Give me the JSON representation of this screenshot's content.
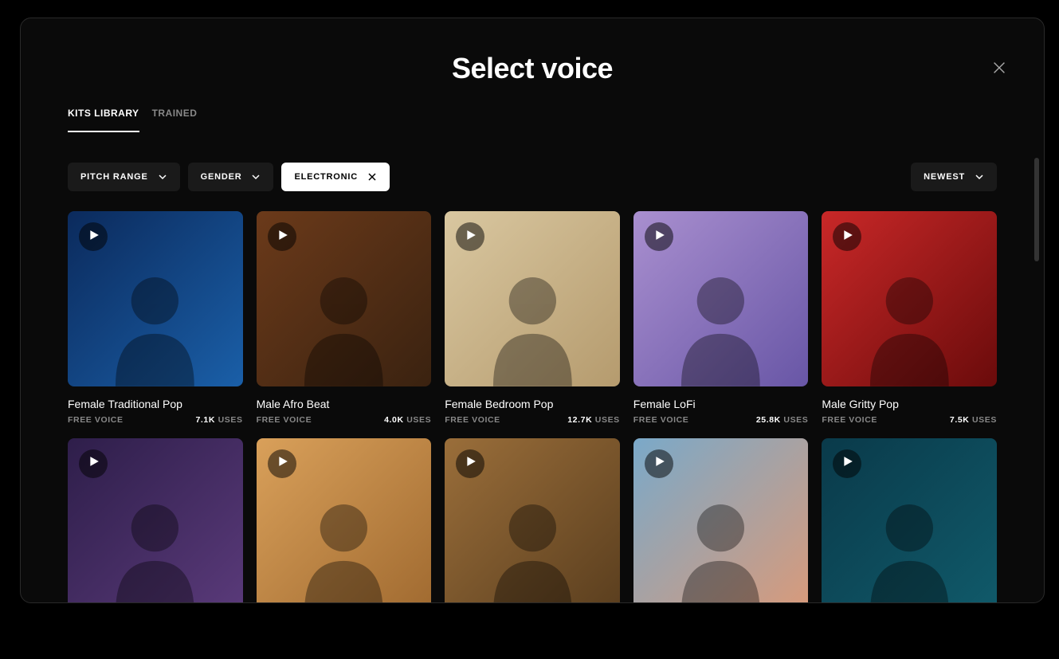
{
  "modal": {
    "title": "Select voice"
  },
  "tabs": [
    {
      "label": "KITS LIBRARY",
      "active": true
    },
    {
      "label": "TRAINED",
      "active": false
    }
  ],
  "filters": {
    "left": [
      {
        "label": "PITCH RANGE",
        "type": "dropdown"
      },
      {
        "label": "GENDER",
        "type": "dropdown"
      },
      {
        "label": "ELECTRONIC",
        "type": "tag",
        "active": true
      }
    ],
    "sort": {
      "label": "NEWEST"
    }
  },
  "uses_suffix": "USES",
  "voices": [
    {
      "title": "Female Traditional Pop",
      "badge": "FREE VOICE",
      "uses": "7.1K"
    },
    {
      "title": "Male Afro Beat",
      "badge": "FREE VOICE",
      "uses": "4.0K"
    },
    {
      "title": "Female Bedroom Pop",
      "badge": "FREE VOICE",
      "uses": "12.7K"
    },
    {
      "title": "Female LoFi",
      "badge": "FREE VOICE",
      "uses": "25.8K"
    },
    {
      "title": "Male Gritty Pop",
      "badge": "FREE VOICE",
      "uses": "7.5K"
    },
    {
      "title": "",
      "badge": "",
      "uses": ""
    },
    {
      "title": "",
      "badge": "",
      "uses": ""
    },
    {
      "title": "",
      "badge": "",
      "uses": ""
    },
    {
      "title": "",
      "badge": "",
      "uses": ""
    },
    {
      "title": "",
      "badge": "",
      "uses": ""
    }
  ]
}
